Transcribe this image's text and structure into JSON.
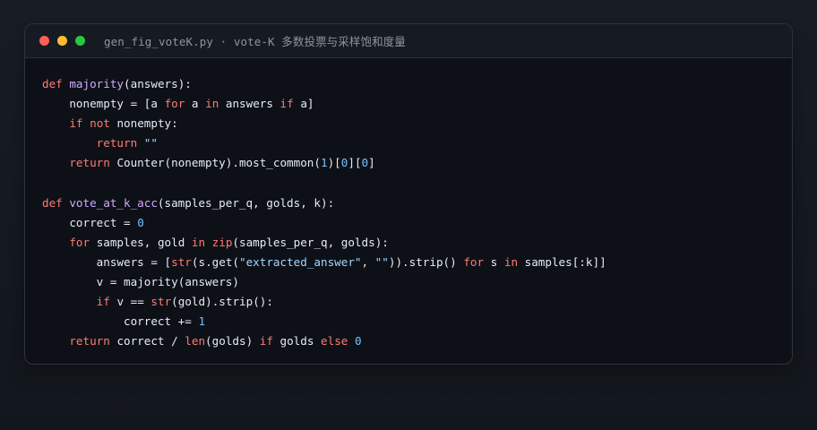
{
  "window": {
    "title": "gen_fig_voteK.py · vote-K 多数投票与采样饱和度量",
    "controls": {
      "close_color": "#ff5f57",
      "minimize_color": "#febc2e",
      "maximize_color": "#28c840"
    }
  },
  "editor": {
    "language": "python",
    "lines": [
      "def majority(answers):",
      "    nonempty = [a for a in answers if a]",
      "    if not nonempty:",
      "        return \"\"",
      "    return Counter(nonempty).most_common(1)[0][0]",
      "",
      "def vote_at_k_acc(samples_per_q, golds, k):",
      "    correct = 0",
      "    for samples, gold in zip(samples_per_q, golds):",
      "        answers = [str(s.get(\"extracted_answer\", \"\")).strip() for s in samples[:k]]",
      "        v = majority(answers)",
      "        if v == str(gold).strip():",
      "            correct += 1",
      "    return correct / len(golds) if golds else 0"
    ]
  },
  "colors": {
    "keyword": "#ff7b72",
    "function": "#d2a8ff",
    "number": "#79c0ff",
    "string": "#a5d6ff",
    "text": "#e6edf3",
    "background": "#0d1117"
  }
}
